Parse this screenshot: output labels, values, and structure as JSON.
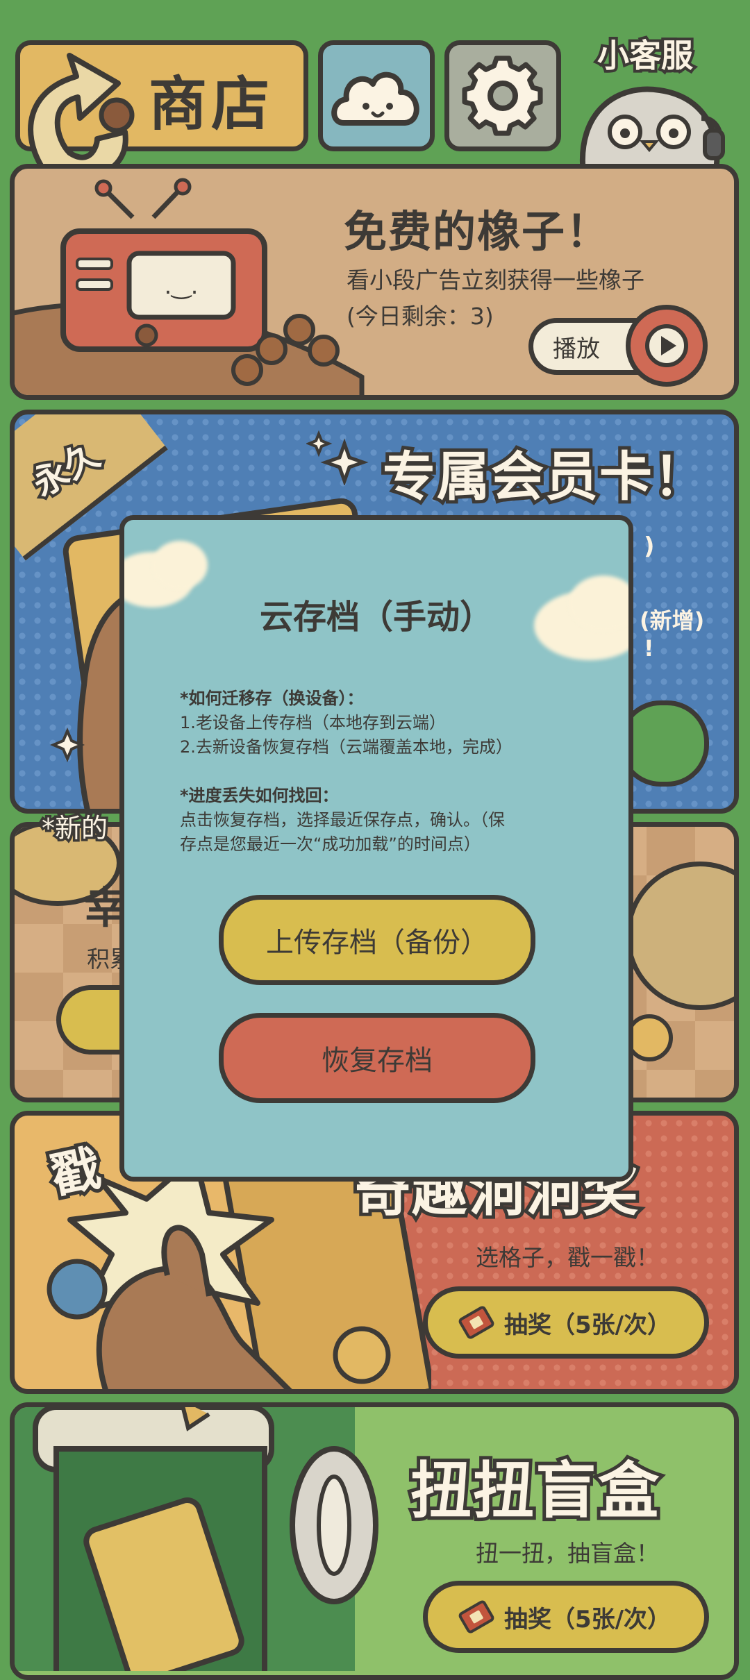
{
  "header": {
    "shop_label": "商店",
    "support_label": "小客服"
  },
  "ad_card": {
    "title": "免费的橡子！",
    "desc": "看小段广告立刻获得一些橡子",
    "remaining": "(今日剩余：3)",
    "play_label": "播放"
  },
  "vip_card": {
    "badge": "永久",
    "title": "专属会员卡！",
    "peek_right_1": ")",
    "peek_right_2": "(新增)",
    "peek_right_3": "!"
  },
  "lucky_card": {
    "notice_prefix": "*新的",
    "title_fragment": "幸",
    "desc_fragment": "积累"
  },
  "poke_card": {
    "poke_label": "戳",
    "title": "奇趣洞洞奖",
    "subtitle": "选格子，戳一戳！",
    "draw_label": "抽奖（5张/次）"
  },
  "gacha_card": {
    "title": "扭扭盲盒",
    "subtitle": "扭一扭，抽盲盒！",
    "draw_label": "抽奖（5张/次）"
  },
  "modal": {
    "title": "云存档（手动）",
    "migrate_heading": "*如何迁移存（换设备）：",
    "migrate_step1": "1.老设备上传存档（本地存到云端）",
    "migrate_step2": "2.去新设备恢复存档（云端覆盖本地，完成）",
    "recover_heading": "*进度丢失如何找回：",
    "recover_text_1": "点击恢复存档，选择最近保存点，确认。（保",
    "recover_text_2": "存点是您最近一次“成功加载”的时间点）",
    "upload_label": "上传存档（备份）",
    "restore_label": "恢复存档"
  },
  "colors": {
    "background": "#5fa255",
    "modal_bg": "#8fc4c7",
    "upload_btn": "#d8bd4f",
    "restore_btn": "#cf6a55",
    "outline": "#3d3a36"
  }
}
